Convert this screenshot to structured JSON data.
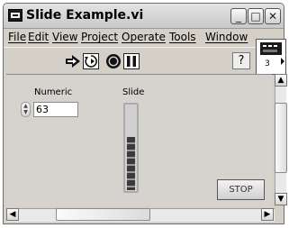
{
  "window": {
    "title": "Slide Example.vi",
    "buttons": {
      "minimize": "_",
      "maximize": "□",
      "close": "✕"
    }
  },
  "menu": [
    "File",
    "Edit",
    "View",
    "Project",
    "Operate",
    "Tools",
    "Window"
  ],
  "menu_mnemonics": [
    "F",
    "E",
    "V",
    "P",
    "O",
    "T",
    "W"
  ],
  "toolbar": {
    "help": "?",
    "connector_number": "3"
  },
  "panel": {
    "numeric": {
      "label": "Numeric",
      "value": "63"
    },
    "slide": {
      "label": "Slide",
      "level": 0.63
    },
    "stop_label": "STOP"
  },
  "colors": {
    "panel_bg": "#d6d3ce",
    "window_bg": "#d4d0c8"
  }
}
